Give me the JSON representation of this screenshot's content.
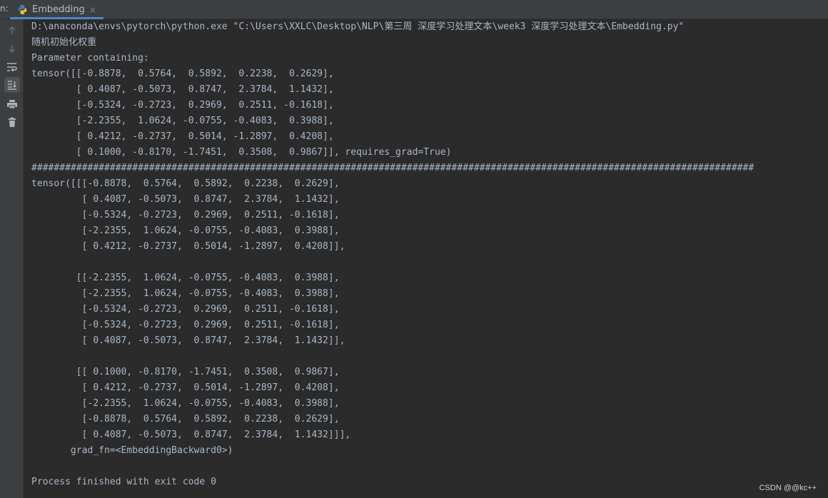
{
  "tabbar": {
    "run_prefix": "n:",
    "tab_label": "Embedding",
    "tab_icon": "python-file-icon",
    "close_glyph": "×",
    "accent_color": "#4a88c7"
  },
  "toolbar": {
    "items": [
      {
        "name": "scroll-up-icon"
      },
      {
        "name": "scroll-down-icon"
      },
      {
        "name": "soft-wrap-icon"
      },
      {
        "name": "scroll-to-end-icon",
        "active": true
      },
      {
        "name": "print-icon"
      },
      {
        "name": "trash-icon"
      }
    ]
  },
  "console": {
    "lines": [
      "D:\\anaconda\\envs\\pytorch\\python.exe \"C:\\Users\\XXLC\\Desktop\\NLP\\第三周 深度学习处理文本\\week3 深度学习处理文本\\Embedding.py\"",
      "随机初始化权重",
      "Parameter containing:",
      "tensor([[-0.8878,  0.5764,  0.5892,  0.2238,  0.2629],",
      "        [ 0.4087, -0.5073,  0.8747,  2.3784,  1.1432],",
      "        [-0.5324, -0.2723,  0.2969,  0.2511, -0.1618],",
      "        [-2.2355,  1.0624, -0.0755, -0.4083,  0.3988],",
      "        [ 0.4212, -0.2737,  0.5014, -1.2897,  0.4208],",
      "        [ 0.1000, -0.8170, -1.7451,  0.3508,  0.9867]], requires_grad=True)",
      "#################################################################################################################################",
      "tensor([[[-0.8878,  0.5764,  0.5892,  0.2238,  0.2629],",
      "         [ 0.4087, -0.5073,  0.8747,  2.3784,  1.1432],",
      "         [-0.5324, -0.2723,  0.2969,  0.2511, -0.1618],",
      "         [-2.2355,  1.0624, -0.0755, -0.4083,  0.3988],",
      "         [ 0.4212, -0.2737,  0.5014, -1.2897,  0.4208]],",
      "",
      "        [[-2.2355,  1.0624, -0.0755, -0.4083,  0.3988],",
      "         [-2.2355,  1.0624, -0.0755, -0.4083,  0.3988],",
      "         [-0.5324, -0.2723,  0.2969,  0.2511, -0.1618],",
      "         [-0.5324, -0.2723,  0.2969,  0.2511, -0.1618],",
      "         [ 0.4087, -0.5073,  0.8747,  2.3784,  1.1432]],",
      "",
      "        [[ 0.1000, -0.8170, -1.7451,  0.3508,  0.9867],",
      "         [ 0.4212, -0.2737,  0.5014, -1.2897,  0.4208],",
      "         [-2.2355,  1.0624, -0.0755, -0.4083,  0.3988],",
      "         [-0.8878,  0.5764,  0.5892,  0.2238,  0.2629],",
      "         [ 0.4087, -0.5073,  0.8747,  2.3784,  1.1432]]],",
      "       grad_fn=<EmbeddingBackward0>)",
      "",
      "Process finished with exit code 0"
    ],
    "text_color": "#a9b7c6",
    "background": "#2b2b2b"
  },
  "watermark": "CSDN @@kc++"
}
